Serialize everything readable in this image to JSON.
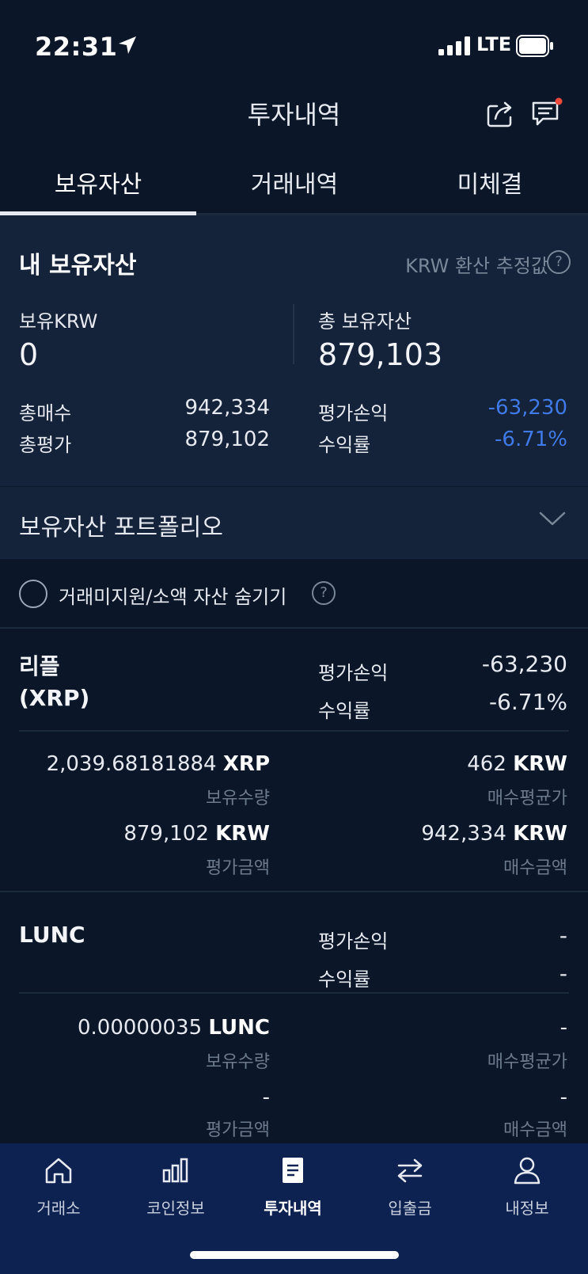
{
  "status": {
    "time": "22:31",
    "network": "LTE"
  },
  "header": {
    "title": "투자내역"
  },
  "tabs": [
    {
      "label": "보유자산",
      "active": true
    },
    {
      "label": "거래내역",
      "active": false
    },
    {
      "label": "미체결",
      "active": false
    }
  ],
  "summary": {
    "title": "내 보유자산",
    "krw_note": "KRW 환산 추정값",
    "held_krw_label": "보유KRW",
    "held_krw_value": "0",
    "total_assets_label": "총 보유자산",
    "total_assets_value": "879,103",
    "total_buy_label": "총매수",
    "total_buy_value": "942,334",
    "total_eval_label": "총평가",
    "total_eval_value": "879,102",
    "pnl_label": "평가손익",
    "pnl_value": "-63,230",
    "roi_label": "수익률",
    "roi_value": "-6.71%"
  },
  "portfolio": {
    "label": "보유자산 포트폴리오"
  },
  "hide_small": {
    "label": "거래미지원/소액 자산 숨기기"
  },
  "assets": [
    {
      "name": "리플",
      "ticker": "(XRP)",
      "pnl_label": "평가손익",
      "pnl_value": "-63,230",
      "roi_label": "수익률",
      "roi_value": "-6.71%",
      "qty_number": "2,039.68181884",
      "qty_unit": "XRP",
      "qty_label": "보유수량",
      "avg_number": "462",
      "avg_unit": "KRW",
      "avg_label": "매수평균가",
      "eval_number": "879,102",
      "eval_unit": "KRW",
      "eval_label": "평가금액",
      "buy_number": "942,334",
      "buy_unit": "KRW",
      "buy_label": "매수금액"
    },
    {
      "name": "LUNC",
      "pnl_label": "평가손익",
      "pnl_value": "-",
      "roi_label": "수익률",
      "roi_value": "-",
      "qty_number": "0.00000035",
      "qty_unit": "LUNC",
      "qty_label": "보유수량",
      "avg_value": "-",
      "avg_label": "매수평균가",
      "eval_value": "-",
      "eval_label": "평가금액",
      "buy_value": "-",
      "buy_label": "매수금액"
    }
  ],
  "nav": [
    {
      "label": "거래소",
      "icon": "home-icon"
    },
    {
      "label": "코인정보",
      "icon": "chart-icon"
    },
    {
      "label": "투자내역",
      "icon": "document-icon",
      "active": true
    },
    {
      "label": "입출금",
      "icon": "transfer-icon"
    },
    {
      "label": "내정보",
      "icon": "user-icon"
    }
  ],
  "colors": {
    "background": "#0b1729",
    "panel": "#14223a",
    "negative": "#3f7ae6",
    "nav": "#0e2252"
  }
}
